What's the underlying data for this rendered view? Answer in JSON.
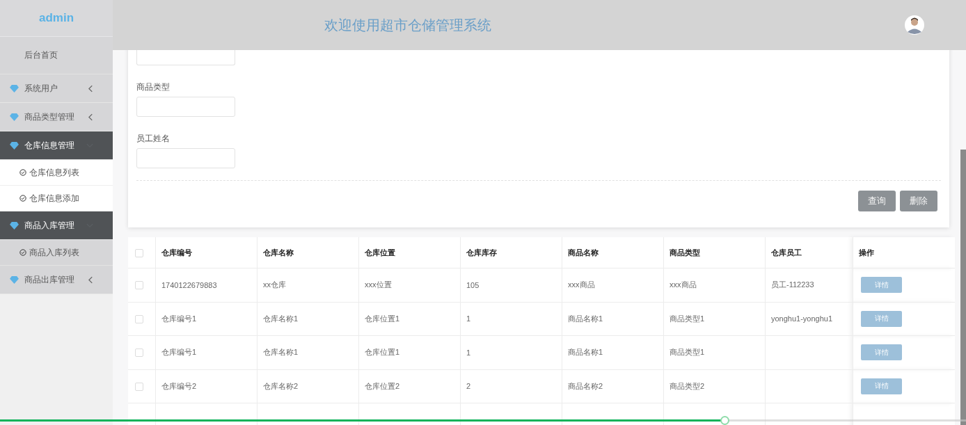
{
  "sidebar": {
    "brand": "admin",
    "home": "后台首页",
    "groups": [
      {
        "label": "系统用户",
        "expanded": false
      },
      {
        "label": "商品类型管理",
        "expanded": false
      },
      {
        "label": "仓库信息管理",
        "expanded": true,
        "children": [
          {
            "label": "仓库信息列表",
            "highlighted": true
          },
          {
            "label": "仓库信息添加",
            "highlighted": true
          }
        ]
      },
      {
        "label": "商品入库管理",
        "expanded": true,
        "children": [
          {
            "label": "商品入库列表",
            "highlighted": false
          }
        ]
      },
      {
        "label": "商品出库管理",
        "expanded": false
      }
    ]
  },
  "header": {
    "title": "欢迎使用超市仓储管理系统"
  },
  "search_form": {
    "fields": [
      {
        "kind": "input"
      },
      {
        "kind": "labeled-input",
        "label": "商品类型"
      },
      {
        "kind": "labeled-input",
        "label": "员工姓名"
      }
    ],
    "buttons": [
      "查询",
      "删除"
    ]
  },
  "table": {
    "select_all": {
      "checked": false
    },
    "columns": [
      "仓库编号",
      "仓库名称",
      "仓库位置",
      "仓库库存",
      "商品名称",
      "商品类型",
      "仓库员工",
      "操作"
    ],
    "rows": [
      {
        "checked": false,
        "cells": [
          "1740122679883",
          "xx仓库",
          "xxx位置",
          "105",
          "xxx商品",
          "xxx商品",
          "员工-112233"
        ],
        "action": "详情"
      },
      {
        "checked": false,
        "cells": [
          "仓库编号1",
          "仓库名称1",
          "仓库位置1",
          "1",
          "商品名称1",
          "商品类型1",
          "yonghu1-yonghu1"
        ],
        "action": "详情"
      },
      {
        "checked": false,
        "cells": [
          "仓库编号1",
          "仓库名称1",
          "仓库位置1",
          "1",
          "商品名称1",
          "商品类型1",
          ""
        ],
        "action": "详情"
      },
      {
        "checked": false,
        "cells": [
          "仓库编号2",
          "仓库名称2",
          "仓库位置2",
          "2",
          "商品名称2",
          "商品类型2",
          ""
        ],
        "action": "详情"
      }
    ]
  },
  "playback_bar": {
    "level": 0.75
  }
}
